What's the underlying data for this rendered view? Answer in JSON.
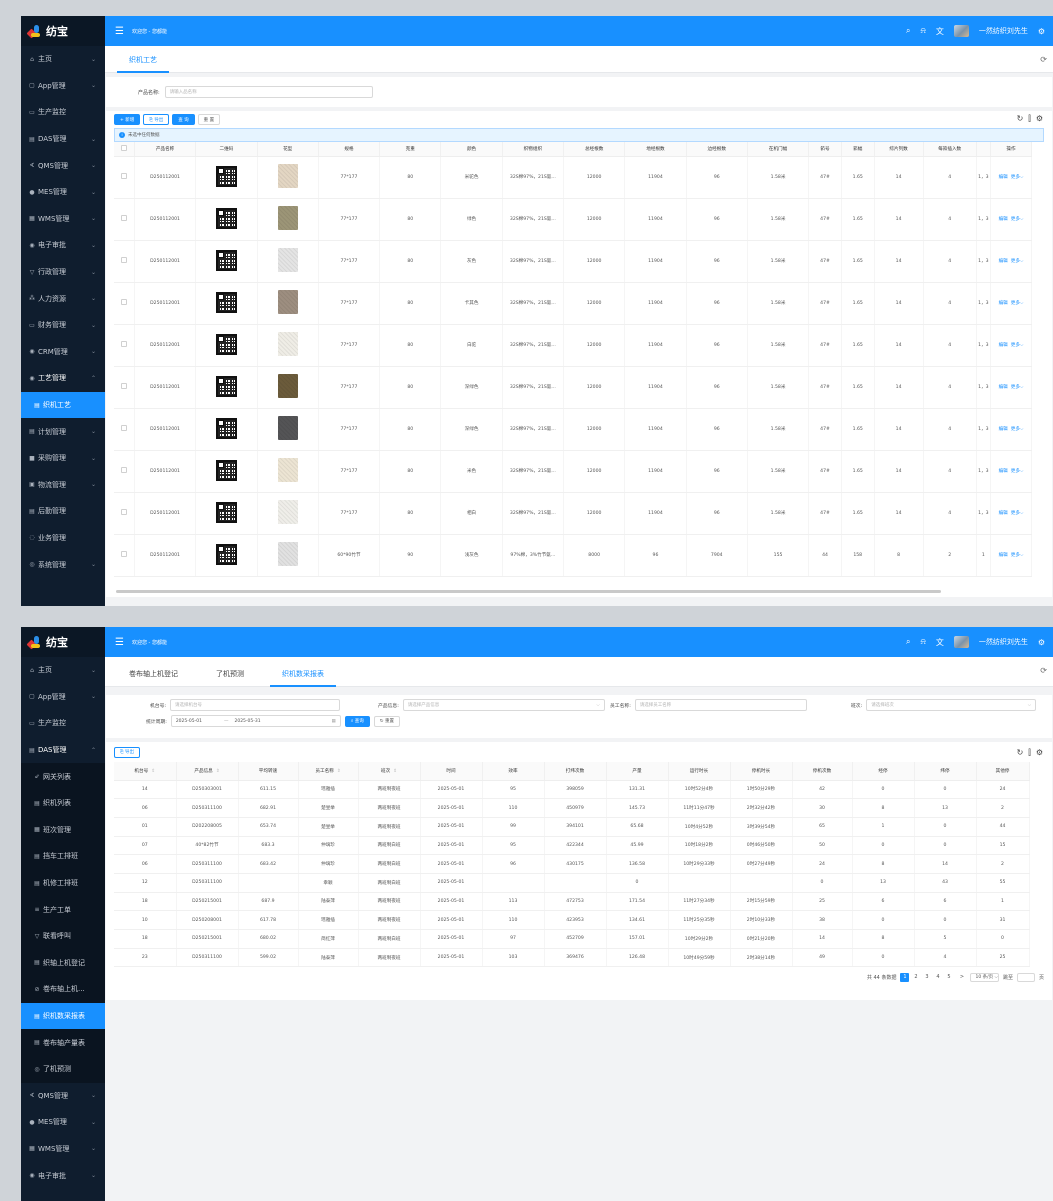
{
  "app": {
    "name": "纺宝"
  },
  "colors": {
    "primary": "#1890ff",
    "sidebar": "#0f1d2e"
  },
  "topbar": {
    "welcome": "欢迎您 - 您都能",
    "user": "一然纺织刘先生"
  },
  "icons": [
    "menu-fold-icon",
    "search-icon",
    "bell-icon",
    "translate-icon",
    "settings-icon",
    "refresh-icon",
    "column-height-icon",
    "gear-icon"
  ],
  "screen1": {
    "sidebar": [
      {
        "icon": "⌂",
        "label": "主页",
        "arrow": "⌄"
      },
      {
        "icon": "▢",
        "label": "App管理",
        "arrow": "⌄"
      },
      {
        "icon": "▭",
        "label": "生产监控",
        "arrow": ""
      },
      {
        "icon": "▤",
        "label": "DAS管理",
        "arrow": "⌄"
      },
      {
        "icon": "∢",
        "label": "QMS管理",
        "arrow": "⌄"
      },
      {
        "icon": "●",
        "label": "MES管理",
        "arrow": "⌄"
      },
      {
        "icon": "▦",
        "label": "WMS管理",
        "arrow": "⌄"
      },
      {
        "icon": "◉",
        "label": "电子审批",
        "arrow": "⌄"
      },
      {
        "icon": "▽",
        "label": "行政管理",
        "arrow": "⌄"
      },
      {
        "icon": "⁂",
        "label": "人力资源",
        "arrow": "⌄"
      },
      {
        "icon": "▭",
        "label": "财务管理",
        "arrow": "⌄"
      },
      {
        "icon": "◉",
        "label": "CRM管理",
        "arrow": "⌄"
      },
      {
        "icon": "◉",
        "label": "工艺管理",
        "arrow": "⌃"
      },
      {
        "icon": "▤",
        "label": "织机工艺",
        "arrow": ""
      },
      {
        "icon": "▤",
        "label": "计划管理",
        "arrow": "⌄"
      },
      {
        "icon": "■",
        "label": "采购管理",
        "arrow": "⌄"
      },
      {
        "icon": "▣",
        "label": "物流管理",
        "arrow": "⌄"
      },
      {
        "icon": "▤",
        "label": "后勤管理",
        "arrow": ""
      },
      {
        "icon": "◌",
        "label": "业务管理",
        "arrow": ""
      },
      {
        "icon": "◎",
        "label": "系统管理",
        "arrow": "⌄"
      }
    ],
    "tabs": [
      "织机工艺"
    ],
    "search": {
      "label": "产品名称:",
      "placeholder": "请输入品名称"
    },
    "toolbar": {
      "add": "+ 新增",
      "export": "导出",
      "query": "查 询",
      "reset": "重 置"
    },
    "alert": "未选中任何数据",
    "columns": [
      "产品名称",
      "二维码",
      "花型",
      "规格",
      "克重",
      "颜色",
      "织物组织",
      "总经根数",
      "地经根数",
      "边经根数",
      "在机门幅",
      "筘号",
      "筘幅",
      "综片列数",
      "每筘插入数",
      "",
      "操作"
    ],
    "rows": [
      {
        "name": "D250112001",
        "spec": "77*177",
        "weight": "80",
        "color": "米驼色",
        "org": "32S棉97%，21S氨...",
        "total": "12000",
        "ground": "11904",
        "edge": "96",
        "width": "1.58米",
        "reed": "47#",
        "reedw": "1.65",
        "heald": "14",
        "ins": "4",
        "extra": "1，3",
        "edit": "编辑",
        "more": "更多⌵",
        "swatch": "#e3d6c3"
      },
      {
        "name": "D250112001",
        "spec": "77*177",
        "weight": "80",
        "color": "绿色",
        "org": "32S棉97%，21S氨...",
        "total": "12000",
        "ground": "11904",
        "edge": "96",
        "width": "1.58米",
        "reed": "47#",
        "reedw": "1.65",
        "heald": "14",
        "ins": "4",
        "extra": "1，3",
        "edit": "编辑",
        "more": "更多⌵",
        "swatch": "#9c9577"
      },
      {
        "name": "D250112001",
        "spec": "77*177",
        "weight": "80",
        "color": "灰色",
        "org": "32S棉97%，21S氨...",
        "total": "12000",
        "ground": "11904",
        "edge": "96",
        "width": "1.58米",
        "reed": "47#",
        "reedw": "1.65",
        "heald": "14",
        "ins": "4",
        "extra": "1，3",
        "edit": "编辑",
        "more": "更多⌵",
        "swatch": "#e4e4e4"
      },
      {
        "name": "D250112001",
        "spec": "77*177",
        "weight": "80",
        "color": "卡其色",
        "org": "32S棉97%，21S氨...",
        "total": "12000",
        "ground": "11904",
        "edge": "96",
        "width": "1.58米",
        "reed": "47#",
        "reedw": "1.65",
        "heald": "14",
        "ins": "4",
        "extra": "1，3",
        "edit": "编辑",
        "more": "更多⌵",
        "swatch": "#9d8e80"
      },
      {
        "name": "D250112001",
        "spec": "77*177",
        "weight": "80",
        "color": "白驼",
        "org": "32S棉97%，21S氨...",
        "total": "12000",
        "ground": "11904",
        "edge": "96",
        "width": "1.58米",
        "reed": "47#",
        "reedw": "1.65",
        "heald": "14",
        "ins": "4",
        "extra": "1，3",
        "edit": "编辑",
        "more": "更多⌵",
        "swatch": "#efede6"
      },
      {
        "name": "D250112001",
        "spec": "77*177",
        "weight": "80",
        "color": "深绿色",
        "org": "32S棉97%，21S氨...",
        "total": "12000",
        "ground": "11904",
        "edge": "96",
        "width": "1.58米",
        "reed": "47#",
        "reedw": "1.65",
        "heald": "14",
        "ins": "4",
        "extra": "1，3",
        "edit": "编辑",
        "more": "更多⌵",
        "swatch": "#6b5b3b"
      },
      {
        "name": "D250112001",
        "spec": "77*177",
        "weight": "80",
        "color": "深绿色",
        "org": "32S棉97%，21S氨...",
        "total": "12000",
        "ground": "11904",
        "edge": "96",
        "width": "1.58米",
        "reed": "47#",
        "reedw": "1.65",
        "heald": "14",
        "ins": "4",
        "extra": "1，3",
        "edit": "编辑",
        "more": "更多⌵",
        "swatch": "#545456"
      },
      {
        "name": "D250112001",
        "spec": "77*177",
        "weight": "80",
        "color": "米色",
        "org": "32S棉97%，21S氨...",
        "total": "12000",
        "ground": "11904",
        "edge": "96",
        "width": "1.58米",
        "reed": "47#",
        "reedw": "1.65",
        "heald": "14",
        "ins": "4",
        "extra": "1，3",
        "edit": "编辑",
        "more": "更多⌵",
        "swatch": "#ece4d3"
      },
      {
        "name": "D250112001",
        "spec": "77*177",
        "weight": "80",
        "color": "相白",
        "org": "32S棉97%，21S氨...",
        "total": "12000",
        "ground": "11904",
        "edge": "96",
        "width": "1.58米",
        "reed": "47#",
        "reedw": "1.65",
        "heald": "14",
        "ins": "4",
        "extra": "1，3",
        "edit": "编辑",
        "more": "更多⌵",
        "swatch": "#efeee9"
      },
      {
        "name": "D250112001",
        "spec": "60*90竹节",
        "weight": "90",
        "color": "浅灰色",
        "org": "97%棉，3%竹节氨...",
        "total": "8000",
        "ground": "96",
        "edge": "7904",
        "width": "155",
        "reed": "44",
        "reedw": "158",
        "heald": "8",
        "ins": "2",
        "extra": "1",
        "edit": "编辑",
        "more": "更多⌵",
        "swatch": "#e1e1e1"
      }
    ]
  },
  "screen2": {
    "sidebar": [
      {
        "icon": "⌂",
        "label": "主页",
        "arrow": "⌄",
        "kind": ""
      },
      {
        "icon": "▢",
        "label": "App管理",
        "arrow": "⌄",
        "kind": ""
      },
      {
        "icon": "▭",
        "label": "生产监控",
        "arrow": "",
        "kind": ""
      },
      {
        "icon": "▤",
        "label": "DAS管理",
        "arrow": "⌃",
        "kind": "open"
      },
      {
        "icon": "⇙",
        "label": "网关列表",
        "arrow": "",
        "kind": "sub"
      },
      {
        "icon": "▤",
        "label": "织机列表",
        "arrow": "",
        "kind": "sub"
      },
      {
        "icon": "▦",
        "label": "班次管理",
        "arrow": "",
        "kind": "sub"
      },
      {
        "icon": "▤",
        "label": "挡车工排班",
        "arrow": "",
        "kind": "sub"
      },
      {
        "icon": "▤",
        "label": "机修工排班",
        "arrow": "",
        "kind": "sub"
      },
      {
        "icon": "≡",
        "label": "生产工单",
        "arrow": "",
        "kind": "sub"
      },
      {
        "icon": "▽",
        "label": "联看呼叫",
        "arrow": "",
        "kind": "sub"
      },
      {
        "icon": "▤",
        "label": "织轴上机登记",
        "arrow": "",
        "kind": "sub"
      },
      {
        "icon": "⊘",
        "label": "卷布轴上机...",
        "arrow": "",
        "kind": "sub"
      },
      {
        "icon": "▤",
        "label": "织机数采报表",
        "arrow": "",
        "kind": "sub active"
      },
      {
        "icon": "▤",
        "label": "卷布轴产量表",
        "arrow": "",
        "kind": "sub"
      },
      {
        "icon": "◎",
        "label": "了机预测",
        "arrow": "",
        "kind": "sub"
      },
      {
        "icon": "∢",
        "label": "QMS管理",
        "arrow": "⌄",
        "kind": ""
      },
      {
        "icon": "●",
        "label": "MES管理",
        "arrow": "⌄",
        "kind": ""
      },
      {
        "icon": "▦",
        "label": "WMS管理",
        "arrow": "⌄",
        "kind": ""
      },
      {
        "icon": "◉",
        "label": "电子审批",
        "arrow": "⌄",
        "kind": ""
      }
    ],
    "tabs": [
      "卷布轴上机登记",
      "了机预测",
      "织机数采报表"
    ],
    "filters": {
      "machine_label": "机台号:",
      "machine_ph": "请选择机台号",
      "product_label": "产品信息:",
      "product_ph": "请选择产品信息",
      "staff_label": "员工名称:",
      "staff_ph": "请选择员工名称",
      "shift_label": "班次:",
      "shift_ph": "请选择班次",
      "date_label": "统计周期:",
      "date_from": "2025-05-01",
      "date_sep": "—",
      "date_to": "2025-05-31",
      "query": "查询",
      "reset": "重置"
    },
    "export": "导出",
    "columns": [
      "机台号",
      "产品信息",
      "平均转速",
      "员工名称",
      "班次",
      "时间",
      "效率",
      "打纬次数",
      "产量",
      "运行时长",
      "停机时长",
      "停机次数",
      "经停",
      "纬停",
      "其他停"
    ],
    "rows": [
      [
        "14",
        "D250303001",
        "611.15",
        "瑶雅插",
        "两班制夜班",
        "2025-05-01",
        "95",
        "398059",
        "131.31",
        "10时52分4秒",
        "1时50分29秒",
        "42",
        "0",
        "0",
        "24"
      ],
      [
        "06",
        "D250311100",
        "682.91",
        "楚昱举",
        "两班制夜班",
        "2025-05-01",
        "110",
        "450979",
        "145.73",
        "11时11分47秒",
        "2时32分42秒",
        "30",
        "8",
        "13",
        "2"
      ],
      [
        "01",
        "D202208005",
        "653.74",
        "楚昱举",
        "两班制夜班",
        "2025-05-01",
        "99",
        "394101",
        "65.68",
        "10时4分52秒",
        "3时39分54秒",
        "65",
        "1",
        "0",
        "44"
      ],
      [
        "07",
        "40*82竹节",
        "683.3",
        "仲璃珍",
        "两班制白班",
        "2025-05-01",
        "95",
        "422344",
        "45.99",
        "10时18分2秒",
        "0时46分50秒",
        "50",
        "0",
        "0",
        "15"
      ],
      [
        "06",
        "D250311100",
        "683.42",
        "仲璃珍",
        "两班制白班",
        "2025-05-01",
        "96",
        "430175",
        "136.58",
        "10时29分33秒",
        "0时27分49秒",
        "24",
        "8",
        "14",
        "2"
      ],
      [
        "12",
        "D250311100",
        "",
        "幸颖",
        "两班制白班",
        "2025-05-01",
        "",
        "",
        "0",
        "",
        "",
        "0",
        "13",
        "43",
        "55"
      ],
      [
        "18",
        "D250215001",
        "687.9",
        "陆泰萍",
        "两班制夜班",
        "2025-05-01",
        "113",
        "472753",
        "171.54",
        "11时27分34秒",
        "2时15分59秒",
        "25",
        "6",
        "6",
        "1"
      ],
      [
        "10",
        "D250208001",
        "617.78",
        "瑶雅插",
        "两班制夜班",
        "2025-05-01",
        "110",
        "423953",
        "134.61",
        "11时25分35秒",
        "2时10分33秒",
        "38",
        "0",
        "0",
        "31"
      ],
      [
        "18",
        "D250215001",
        "680.02",
        "简红萍",
        "两班制白班",
        "2025-05-01",
        "97",
        "452709",
        "157.01",
        "10时29分2秒",
        "0时21分20秒",
        "14",
        "8",
        "5",
        "0"
      ],
      [
        "23",
        "D250311100",
        "599.02",
        "陆泰萍",
        "两班制夜班",
        "2025-05-01",
        "103",
        "369476",
        "126.48",
        "10时49分59秒",
        "2时38分14秒",
        "49",
        "0",
        "4",
        "25"
      ]
    ],
    "pager": {
      "total": "共 44 条数据",
      "pages": [
        "1",
        "2",
        "3",
        "4",
        "5"
      ],
      "next": ">",
      "size": "10 条/页 ⌵",
      "goto": "跳至",
      "unit": "页"
    }
  }
}
